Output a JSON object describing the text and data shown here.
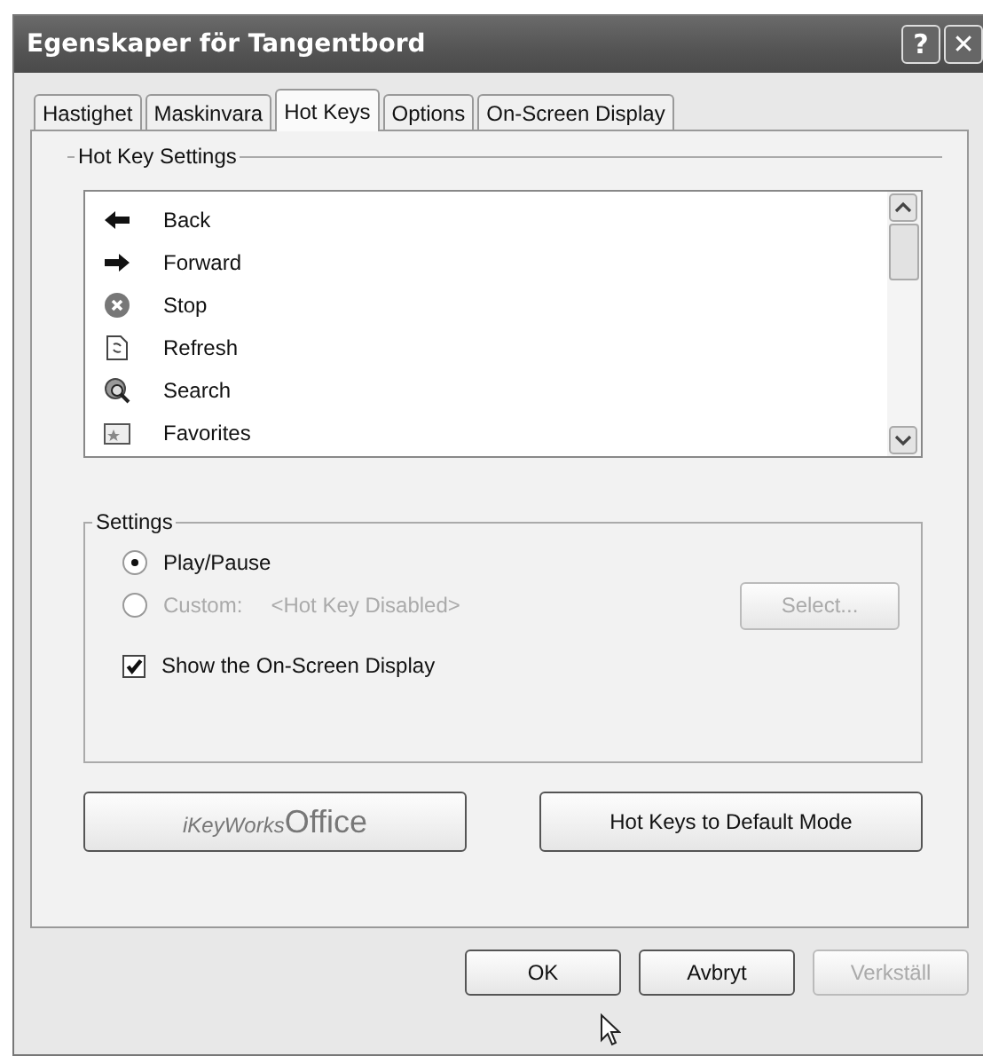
{
  "window": {
    "title": "Egenskaper för Tangentbord",
    "help_button": "?",
    "close_button": "✕"
  },
  "tabs": [
    {
      "label": "Hastighet",
      "selected": false
    },
    {
      "label": "Maskinvara",
      "selected": false
    },
    {
      "label": "Hot Keys",
      "selected": true
    },
    {
      "label": "Options",
      "selected": false
    },
    {
      "label": "On-Screen Display",
      "selected": false
    }
  ],
  "hot_key_settings": {
    "title": "Hot Key Settings",
    "items": [
      {
        "label": "Back",
        "kind": "back"
      },
      {
        "label": "Forward",
        "kind": "forward"
      },
      {
        "label": "Stop",
        "kind": "stop"
      },
      {
        "label": "Refresh",
        "kind": "refresh"
      },
      {
        "label": "Search",
        "kind": "search"
      },
      {
        "label": "Favorites",
        "kind": "favorites"
      }
    ]
  },
  "settings": {
    "title": "Settings",
    "play_pause": {
      "label": "Play/Pause",
      "selected": true
    },
    "custom": {
      "label": "Custom:",
      "selected": false,
      "value": "<Hot Key Disabled>",
      "disabled": true
    },
    "select_button": {
      "label": "Select...",
      "disabled": true
    },
    "show_osd": {
      "label": "Show the On-Screen Display",
      "checked": true
    }
  },
  "logo_button": {
    "prefix": "iKeyWorks",
    "suffix": "Office"
  },
  "default_button": "Hot Keys to  Default Mode",
  "buttons": [
    {
      "label": "OK",
      "disabled": false
    },
    {
      "label": "Avbryt",
      "disabled": false
    },
    {
      "label": "Verkställ",
      "disabled": true
    }
  ]
}
